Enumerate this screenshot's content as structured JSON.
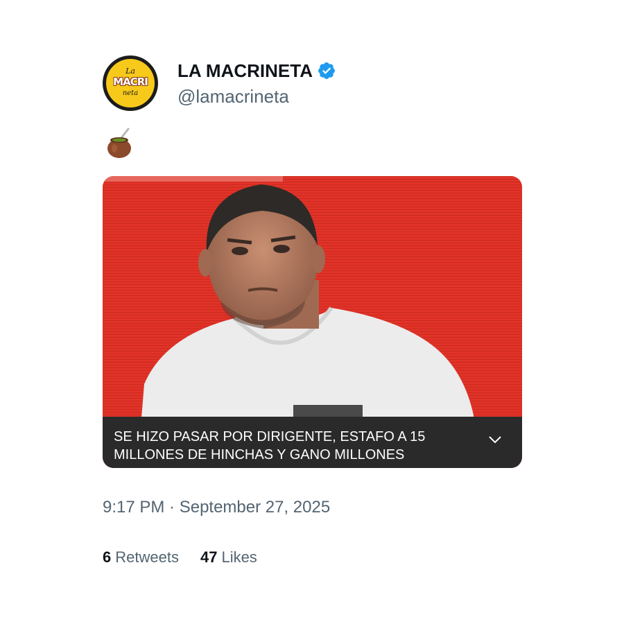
{
  "author": {
    "display_name": "LA MACRINETA",
    "handle": "@lamacrineta",
    "verified_icon": "verified-badge-icon",
    "avatar_text": [
      "La",
      "MACRI",
      "neta"
    ],
    "colors": {
      "avatar_bg": "#f7c91b",
      "verified": "#1d9bf0"
    }
  },
  "tweet": {
    "emoji": "mate-gourd",
    "media": {
      "caption": "SE HIZO PASAR POR DIRIGENTE, ESTAFO A 15 MILLONES DE HINCHAS Y GANO MILLONES",
      "expand_icon": "chevron-down-icon",
      "colors": {
        "background": "#e23328",
        "caption_bar": "#2a2a2a"
      }
    },
    "timestamp": "9:17 PM · September 27, 2025"
  },
  "stats": {
    "retweets": {
      "count": "6",
      "label": "Retweets"
    },
    "likes": {
      "count": "47",
      "label": "Likes"
    }
  }
}
